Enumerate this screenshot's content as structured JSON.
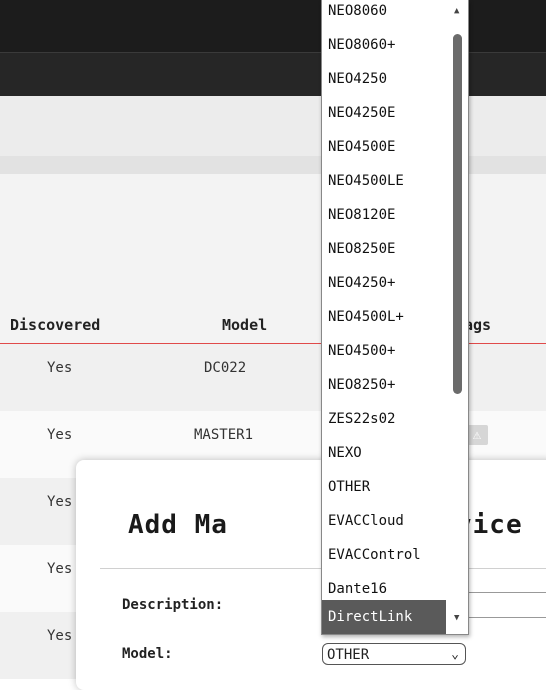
{
  "table": {
    "columns": {
      "discovered": "Discovered",
      "model": "Model",
      "flags": "ags"
    },
    "rows": [
      {
        "discovered": "Yes",
        "model": "DC022"
      },
      {
        "discovered": "Yes",
        "model": "MASTER1"
      },
      {
        "discovered": "Yes",
        "model": ""
      },
      {
        "discovered": "Yes",
        "model": ""
      },
      {
        "discovered": "Yes",
        "model": ""
      }
    ],
    "warning_icon": "warning-triangle-icon"
  },
  "modal": {
    "title_left": "Add Ma",
    "title_right": "vice",
    "description_label": "Description:",
    "model_label": "Model:",
    "model_value": "OTHER"
  },
  "dropdown": {
    "options": [
      "NEO8060",
      "NEO8060+",
      "NEO4250",
      "NEO4250E",
      "NEO4500E",
      "NEO4500LE",
      "NEO8120E",
      "NEO8250E",
      "NEO4250+",
      "NEO4500L+",
      "NEO4500+",
      "NEO8250+",
      "ZES22s02",
      "NEXO",
      "OTHER",
      "EVACCloud",
      "EVACControl",
      "Dante16",
      "DirectLink"
    ],
    "selected": "DirectLink"
  },
  "colors": {
    "accent_line": "#e04a4a",
    "selected_option": "#5a5a5a"
  }
}
